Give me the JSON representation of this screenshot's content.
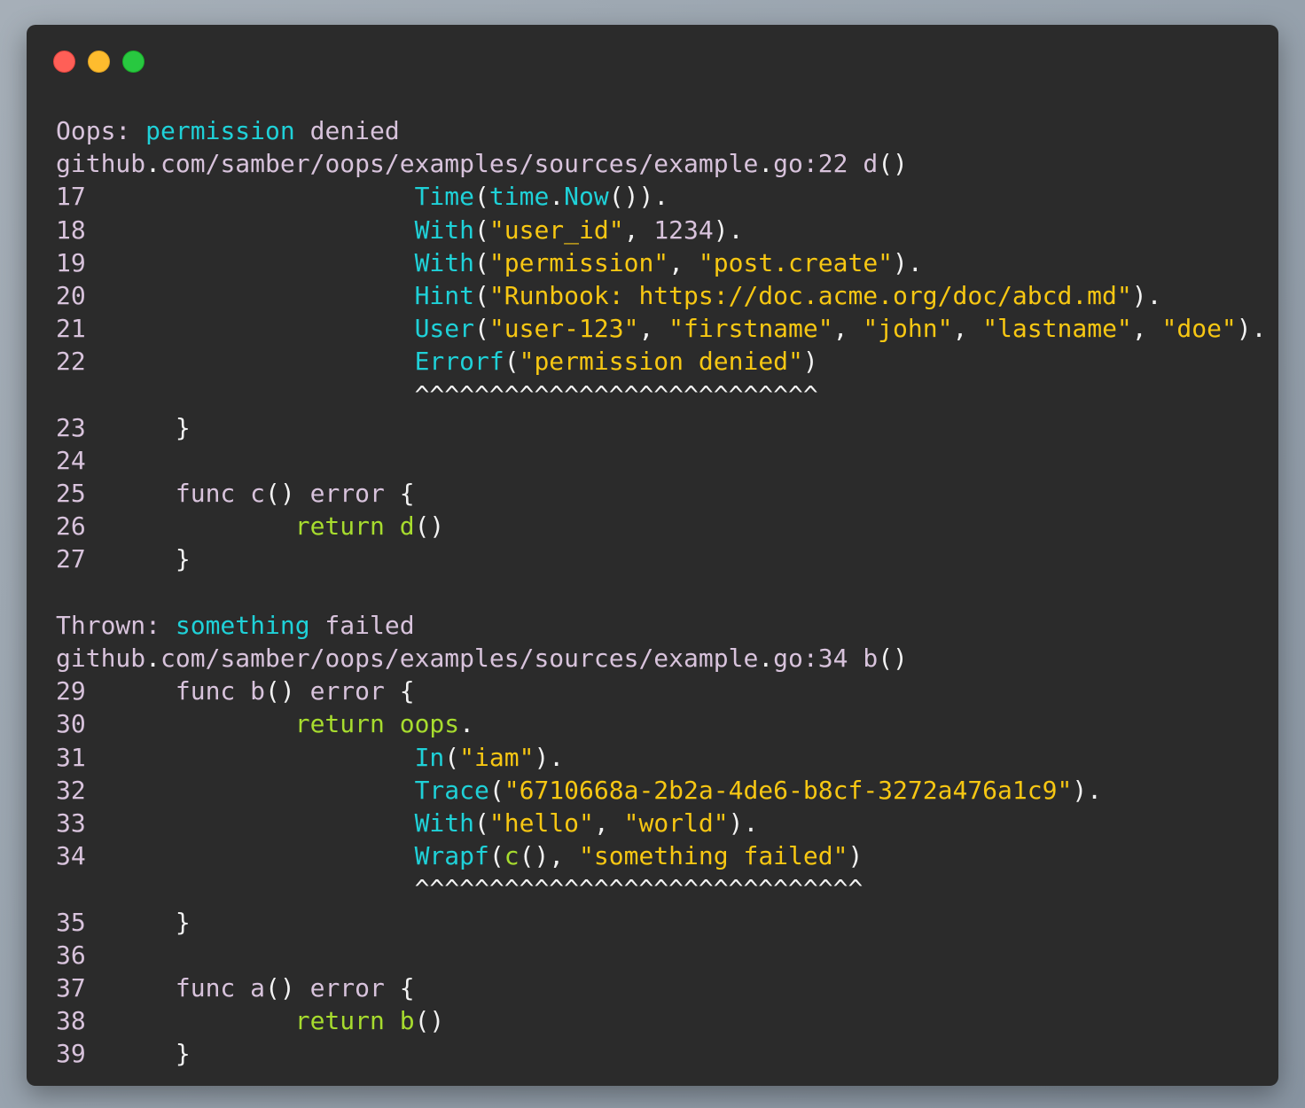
{
  "window": {
    "controls": [
      "close",
      "minimize",
      "zoom"
    ],
    "colors": {
      "close": "#ff5f57",
      "minimize": "#febc2e",
      "zoom": "#28c840",
      "background": "#2b2b2b"
    }
  },
  "theme": {
    "text": "#d8c3dc",
    "punctuation": "#f2f2f2",
    "function": "#1fd1d8",
    "string": "#f7c713",
    "keyword": "#a7dc2e"
  },
  "lines": [
    {
      "kind": "header",
      "tokens": [
        {
          "t": "Oops: ",
          "c": "text"
        },
        {
          "t": "permission",
          "c": "hl"
        },
        {
          "t": " denied",
          "c": "text"
        }
      ]
    },
    {
      "kind": "location",
      "tokens": [
        {
          "t": "github",
          "c": "text"
        },
        {
          "t": ".",
          "c": "punct"
        },
        {
          "t": "com/samber/oops/examples/sources/example",
          "c": "text"
        },
        {
          "t": ".",
          "c": "punct"
        },
        {
          "t": "go:22 d",
          "c": "text"
        },
        {
          "t": "()",
          "c": "punct"
        }
      ]
    },
    {
      "kind": "code",
      "num": "17",
      "indent": 3,
      "tokens": [
        {
          "t": "Time",
          "c": "fn"
        },
        {
          "t": "(",
          "c": "punct"
        },
        {
          "t": "time",
          "c": "fn"
        },
        {
          "t": ".",
          "c": "punct"
        },
        {
          "t": "Now",
          "c": "fn"
        },
        {
          "t": "()).",
          "c": "punct"
        }
      ]
    },
    {
      "kind": "code",
      "num": "18",
      "indent": 3,
      "tokens": [
        {
          "t": "With",
          "c": "fn"
        },
        {
          "t": "(",
          "c": "punct"
        },
        {
          "t": "\"user_id\"",
          "c": "str"
        },
        {
          "t": ", ",
          "c": "punct"
        },
        {
          "t": "1234",
          "c": "num"
        },
        {
          "t": ").",
          "c": "punct"
        }
      ]
    },
    {
      "kind": "code",
      "num": "19",
      "indent": 3,
      "tokens": [
        {
          "t": "With",
          "c": "fn"
        },
        {
          "t": "(",
          "c": "punct"
        },
        {
          "t": "\"permission\"",
          "c": "str"
        },
        {
          "t": ", ",
          "c": "punct"
        },
        {
          "t": "\"post.create\"",
          "c": "str"
        },
        {
          "t": ").",
          "c": "punct"
        }
      ]
    },
    {
      "kind": "code",
      "num": "20",
      "indent": 3,
      "tokens": [
        {
          "t": "Hint",
          "c": "fn"
        },
        {
          "t": "(",
          "c": "punct"
        },
        {
          "t": "\"Runbook: https://doc.acme.org/doc/abcd.md\"",
          "c": "str"
        },
        {
          "t": ").",
          "c": "punct"
        }
      ]
    },
    {
      "kind": "code",
      "num": "21",
      "indent": 3,
      "tokens": [
        {
          "t": "User",
          "c": "fn"
        },
        {
          "t": "(",
          "c": "punct"
        },
        {
          "t": "\"user-123\"",
          "c": "str"
        },
        {
          "t": ", ",
          "c": "punct"
        },
        {
          "t": "\"firstname\"",
          "c": "str"
        },
        {
          "t": ", ",
          "c": "punct"
        },
        {
          "t": "\"john\"",
          "c": "str"
        },
        {
          "t": ", ",
          "c": "punct"
        },
        {
          "t": "\"lastname\"",
          "c": "str"
        },
        {
          "t": ", ",
          "c": "punct"
        },
        {
          "t": "\"doe\"",
          "c": "str"
        },
        {
          "t": ").",
          "c": "punct"
        }
      ]
    },
    {
      "kind": "code",
      "num": "22",
      "indent": 3,
      "tokens": [
        {
          "t": "Errorf",
          "c": "fn"
        },
        {
          "t": "(",
          "c": "punct"
        },
        {
          "t": "\"permission denied\"",
          "c": "str"
        },
        {
          "t": ")",
          "c": "punct"
        }
      ]
    },
    {
      "kind": "caret",
      "indent": 3,
      "tokens": [
        {
          "t": "^^^^^^^^^^^^^^^^^^^^^^^^^^^",
          "c": "caret"
        }
      ]
    },
    {
      "kind": "code",
      "num": "23",
      "indent": 1,
      "tokens": [
        {
          "t": "}",
          "c": "punct"
        }
      ]
    },
    {
      "kind": "code",
      "num": "24",
      "indent": 0,
      "tokens": []
    },
    {
      "kind": "code",
      "num": "25",
      "indent": 1,
      "tokens": [
        {
          "t": "func c",
          "c": "text"
        },
        {
          "t": "()",
          "c": "punct"
        },
        {
          "t": " error ",
          "c": "text"
        },
        {
          "t": "{",
          "c": "punct"
        }
      ]
    },
    {
      "kind": "code",
      "num": "26",
      "indent": 2,
      "tokens": [
        {
          "t": "return d",
          "c": "kw"
        },
        {
          "t": "()",
          "c": "punct"
        }
      ]
    },
    {
      "kind": "code",
      "num": "27",
      "indent": 1,
      "tokens": [
        {
          "t": "}",
          "c": "punct"
        }
      ]
    },
    {
      "kind": "blank",
      "tokens": []
    },
    {
      "kind": "header",
      "tokens": [
        {
          "t": "Thrown: ",
          "c": "text"
        },
        {
          "t": "something",
          "c": "hl"
        },
        {
          "t": " failed",
          "c": "text"
        }
      ]
    },
    {
      "kind": "location",
      "tokens": [
        {
          "t": "github",
          "c": "text"
        },
        {
          "t": ".",
          "c": "punct"
        },
        {
          "t": "com/samber/oops/examples/sources/example",
          "c": "text"
        },
        {
          "t": ".",
          "c": "punct"
        },
        {
          "t": "go:34 b",
          "c": "text"
        },
        {
          "t": "()",
          "c": "punct"
        }
      ]
    },
    {
      "kind": "code",
      "num": "29",
      "indent": 1,
      "tokens": [
        {
          "t": "func b",
          "c": "text"
        },
        {
          "t": "()",
          "c": "punct"
        },
        {
          "t": " error ",
          "c": "text"
        },
        {
          "t": "{",
          "c": "punct"
        }
      ]
    },
    {
      "kind": "code",
      "num": "30",
      "indent": 2,
      "tokens": [
        {
          "t": "return oops",
          "c": "kw"
        },
        {
          "t": ".",
          "c": "punct"
        }
      ]
    },
    {
      "kind": "code",
      "num": "31",
      "indent": 3,
      "tokens": [
        {
          "t": "In",
          "c": "fn"
        },
        {
          "t": "(",
          "c": "punct"
        },
        {
          "t": "\"iam\"",
          "c": "str"
        },
        {
          "t": ").",
          "c": "punct"
        }
      ]
    },
    {
      "kind": "code",
      "num": "32",
      "indent": 3,
      "tokens": [
        {
          "t": "Trace",
          "c": "fn"
        },
        {
          "t": "(",
          "c": "punct"
        },
        {
          "t": "\"6710668a-2b2a-4de6-b8cf-3272a476a1c9\"",
          "c": "str"
        },
        {
          "t": ").",
          "c": "punct"
        }
      ]
    },
    {
      "kind": "code",
      "num": "33",
      "indent": 3,
      "tokens": [
        {
          "t": "With",
          "c": "fn"
        },
        {
          "t": "(",
          "c": "punct"
        },
        {
          "t": "\"hello\"",
          "c": "str"
        },
        {
          "t": ", ",
          "c": "punct"
        },
        {
          "t": "\"world\"",
          "c": "str"
        },
        {
          "t": ").",
          "c": "punct"
        }
      ]
    },
    {
      "kind": "code",
      "num": "34",
      "indent": 3,
      "tokens": [
        {
          "t": "Wrapf",
          "c": "fn"
        },
        {
          "t": "(",
          "c": "punct"
        },
        {
          "t": "c",
          "c": "kw"
        },
        {
          "t": "(), ",
          "c": "punct"
        },
        {
          "t": "\"something failed\"",
          "c": "str"
        },
        {
          "t": ")",
          "c": "punct"
        }
      ]
    },
    {
      "kind": "caret",
      "indent": 3,
      "tokens": [
        {
          "t": "^^^^^^^^^^^^^^^^^^^^^^^^^^^^^^",
          "c": "caret"
        }
      ]
    },
    {
      "kind": "code",
      "num": "35",
      "indent": 1,
      "tokens": [
        {
          "t": "}",
          "c": "punct"
        }
      ]
    },
    {
      "kind": "code",
      "num": "36",
      "indent": 0,
      "tokens": []
    },
    {
      "kind": "code",
      "num": "37",
      "indent": 1,
      "tokens": [
        {
          "t": "func a",
          "c": "text"
        },
        {
          "t": "()",
          "c": "punct"
        },
        {
          "t": " error ",
          "c": "text"
        },
        {
          "t": "{",
          "c": "punct"
        }
      ]
    },
    {
      "kind": "code",
      "num": "38",
      "indent": 2,
      "tokens": [
        {
          "t": "return b",
          "c": "kw"
        },
        {
          "t": "()",
          "c": "punct"
        }
      ]
    },
    {
      "kind": "code",
      "num": "39",
      "indent": 1,
      "tokens": [
        {
          "t": "}",
          "c": "punct"
        }
      ]
    }
  ]
}
